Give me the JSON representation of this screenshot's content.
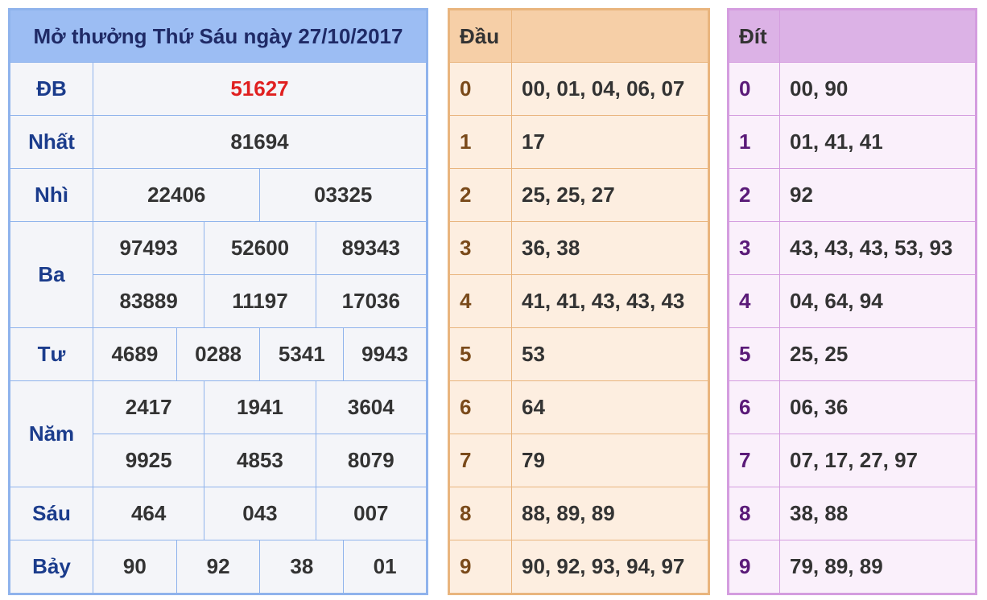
{
  "title": "Mở thưởng Thứ Sáu ngày 27/10/2017",
  "prizes": {
    "db": {
      "label": "ĐB",
      "values": [
        "51627"
      ]
    },
    "nhat": {
      "label": "Nhất",
      "values": [
        "81694"
      ]
    },
    "nhi": {
      "label": "Nhì",
      "values": [
        "22406",
        "03325"
      ]
    },
    "ba": {
      "label": "Ba",
      "values": [
        "97493",
        "52600",
        "89343",
        "83889",
        "11197",
        "17036"
      ]
    },
    "tu": {
      "label": "Tư",
      "values": [
        "4689",
        "0288",
        "5341",
        "9943"
      ]
    },
    "nam": {
      "label": "Năm",
      "values": [
        "2417",
        "1941",
        "3604",
        "9925",
        "4853",
        "8079"
      ]
    },
    "sau": {
      "label": "Sáu",
      "values": [
        "464",
        "043",
        "007"
      ]
    },
    "bay": {
      "label": "Bảy",
      "values": [
        "90",
        "92",
        "38",
        "01"
      ]
    }
  },
  "dau": {
    "header": "Đầu",
    "rows": [
      {
        "key": "0",
        "values": "00, 01, 04, 06, 07"
      },
      {
        "key": "1",
        "values": "17"
      },
      {
        "key": "2",
        "values": "25, 25, 27"
      },
      {
        "key": "3",
        "values": "36, 38"
      },
      {
        "key": "4",
        "values": "41, 41, 43, 43, 43"
      },
      {
        "key": "5",
        "values": "53"
      },
      {
        "key": "6",
        "values": "64"
      },
      {
        "key": "7",
        "values": "79"
      },
      {
        "key": "8",
        "values": "88, 89, 89"
      },
      {
        "key": "9",
        "values": "90, 92, 93, 94, 97"
      }
    ]
  },
  "dit": {
    "header": "Đít",
    "rows": [
      {
        "key": "0",
        "values": "00, 90"
      },
      {
        "key": "1",
        "values": "01, 41, 41"
      },
      {
        "key": "2",
        "values": "92"
      },
      {
        "key": "3",
        "values": "43, 43, 43, 53, 93"
      },
      {
        "key": "4",
        "values": "04, 64, 94"
      },
      {
        "key": "5",
        "values": "25, 25"
      },
      {
        "key": "6",
        "values": "06, 36"
      },
      {
        "key": "7",
        "values": "07, 17, 27, 97"
      },
      {
        "key": "8",
        "values": "38, 88"
      },
      {
        "key": "9",
        "values": "79, 89, 89"
      }
    ]
  },
  "colors": {
    "special": "#e02020",
    "results_border": "#8fb3ec",
    "dau_border": "#e9b57e",
    "dit_border": "#d49ddf"
  }
}
